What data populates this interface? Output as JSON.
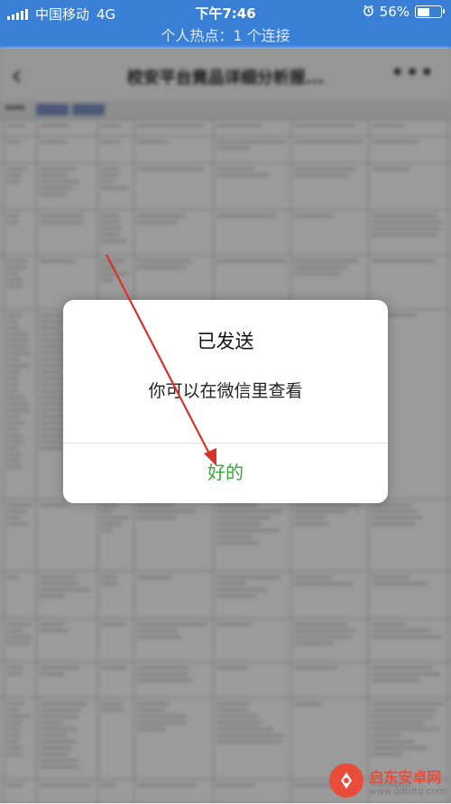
{
  "status_bar": {
    "carrier": "中国移动",
    "network": "4G",
    "time": "下午7:46",
    "battery": "56%",
    "battery_level": 0.56
  },
  "hotspot_banner": "个人热点：1 个连接",
  "nav": {
    "back_icon": "‹",
    "title": "校安平台竟品详细分析报...",
    "more_icon": "•••"
  },
  "dialog": {
    "title": "已发送",
    "message": "你可以在微信里查看",
    "ok_label": "好的",
    "ok_color": "#3aa63a"
  },
  "watermark": {
    "name": "启东安卓网",
    "url": "www.qdtdtq.com"
  },
  "colors": {
    "statusbar": "#3a7fd6",
    "arrow": "#d8322a"
  }
}
